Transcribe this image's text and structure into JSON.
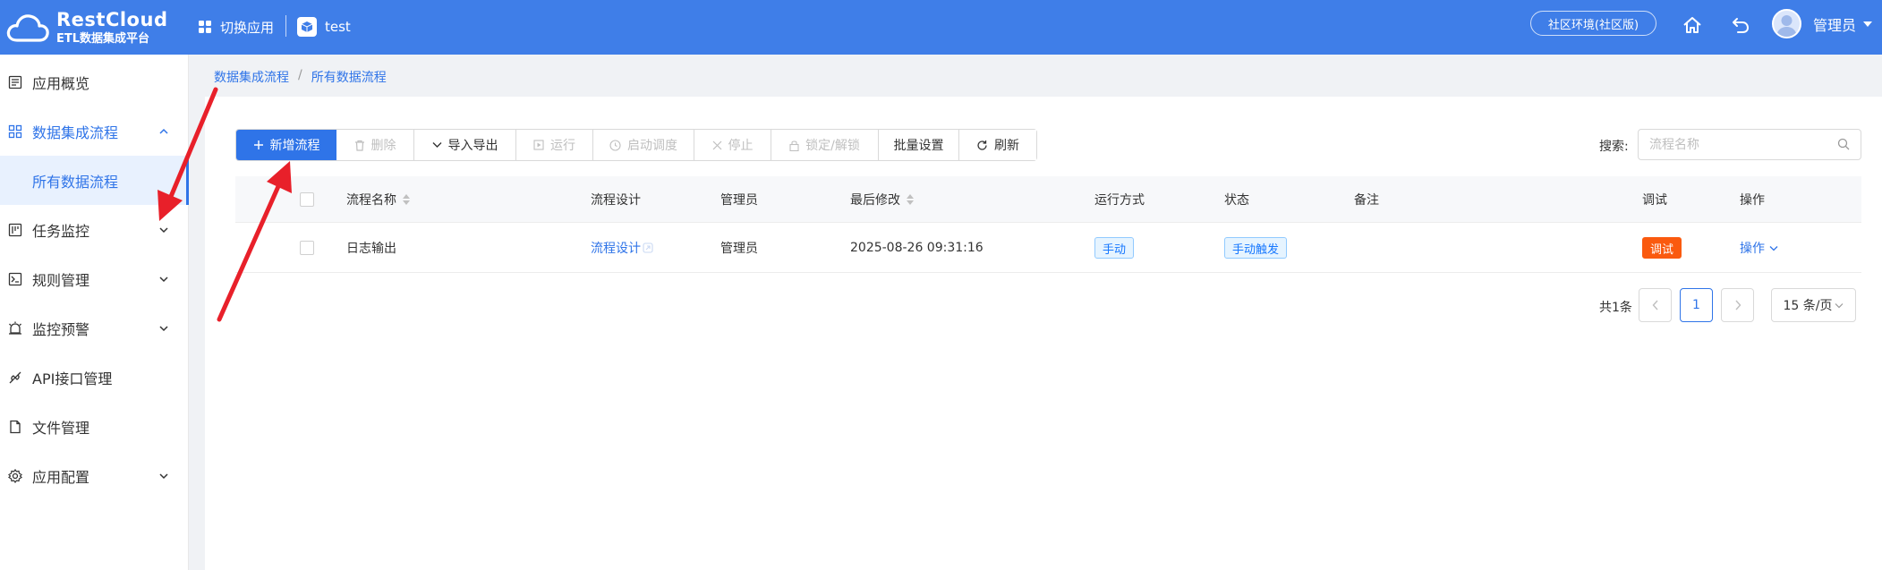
{
  "header": {
    "logo_title": "RestCloud",
    "logo_subtitle": "ETL数据集成平台",
    "switch_app_label": "切换应用",
    "app_name": "test",
    "env_label": "社区环境(社区版)",
    "user_name": "管理员",
    "icons": [
      "grid-icon",
      "cube-icon",
      "home-icon",
      "undo-icon",
      "avatar-icon",
      "caret-down-icon"
    ]
  },
  "sidebar": {
    "items": [
      {
        "label": "应用概览",
        "icon": "list-icon"
      },
      {
        "label": "数据集成流程",
        "icon": "apps-icon",
        "expanded": true
      },
      {
        "label": "所有数据流程",
        "selected": true
      },
      {
        "label": "任务监控",
        "icon": "monitor-icon"
      },
      {
        "label": "规则管理",
        "icon": "terminal-icon"
      },
      {
        "label": "监控预警",
        "icon": "alarm-icon"
      },
      {
        "label": "API接口管理",
        "icon": "api-icon"
      },
      {
        "label": "文件管理",
        "icon": "file-icon"
      },
      {
        "label": "应用配置",
        "icon": "settings-icon"
      }
    ]
  },
  "breadcrumb": {
    "parent": "数据集成流程",
    "separator": "/",
    "current": "所有数据流程"
  },
  "toolbar": {
    "add": "新增流程",
    "delete": "删除",
    "import_export": "导入导出",
    "run": "运行",
    "schedule": "启动调度",
    "stop": "停止",
    "lock": "锁定/解锁",
    "batch": "批量设置",
    "refresh": "刷新"
  },
  "search": {
    "label": "搜索:",
    "placeholder": "流程名称",
    "value": ""
  },
  "table": {
    "columns": [
      "流程名称",
      "流程设计",
      "管理员",
      "最后修改",
      "运行方式",
      "状态",
      "备注",
      "调试",
      "操作"
    ],
    "rows": [
      {
        "name": "日志输出",
        "design": "流程设计",
        "admin": "管理员",
        "modified": "2025-08-26 09:31:16",
        "run_mode": "手动",
        "status": "手动触发",
        "note": "",
        "debug": "调试",
        "action": "操作"
      }
    ]
  },
  "pagination": {
    "total": "共1条",
    "current_page": "1",
    "page_size": "15 条/页"
  },
  "colors": {
    "primary": "#2f74e8",
    "header_bg": "#3f7ee8",
    "debug_orange": "#fa5a0f",
    "annotation_red": "#e8202a"
  }
}
